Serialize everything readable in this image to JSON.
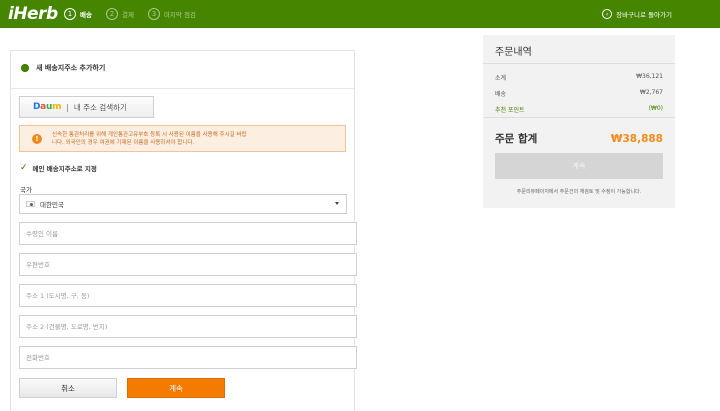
{
  "header": {
    "logo": "iHerb",
    "steps": [
      {
        "num": "1",
        "label": "배송"
      },
      {
        "num": "2",
        "label": "결제"
      },
      {
        "num": "3",
        "label": "마지막 점검"
      }
    ],
    "back_link": "장바구니로 돌아가기",
    "colors": {
      "bar": "#458500"
    }
  },
  "address_form": {
    "section_title": "새 배송지주소 추가하기",
    "daum_button": {
      "logo": "Daum",
      "label": "내 주소 검색하기"
    },
    "notice": {
      "line1": "신속한 통관처리를 위해 개인통관고유부호 등록 시 사용된 이름을 사용해 주시길 바랍",
      "line2": "니다. 외국인의 경우 여권에 기재된 이름을 사용하셔야 합니다."
    },
    "default_checkbox_label": "메인 배송지주소로 지정",
    "country": {
      "label": "국가",
      "value": "대한민국"
    },
    "fields": {
      "name_placeholder": "수령인 이름",
      "postal_placeholder": "우편번호",
      "address1_placeholder": "주소 1 (도시명, 구, 동)",
      "address2_placeholder": "주소 2 (건물명, 도로명, 번지)",
      "phone_placeholder": "전화번호"
    },
    "cancel_label": "취소",
    "continue_label": "계속",
    "colors": {
      "accent": "#f47a00",
      "notice_bg": "#fcefe2"
    }
  },
  "summary": {
    "title": "주문내역",
    "rows": [
      {
        "label": "소계",
        "value": "₩36,121"
      },
      {
        "label": "배송",
        "value": "₩2,767"
      },
      {
        "label": "추천 포인트",
        "value": "(₩0)"
      }
    ],
    "total_label": "주문 합계",
    "total_value": "₩38,888",
    "button_label": "계속",
    "note": "주문리뷰페이지에서 주문건의 재검토 및 수정이 가능합니다.",
    "colors": {
      "total": "#f08c1e"
    }
  }
}
